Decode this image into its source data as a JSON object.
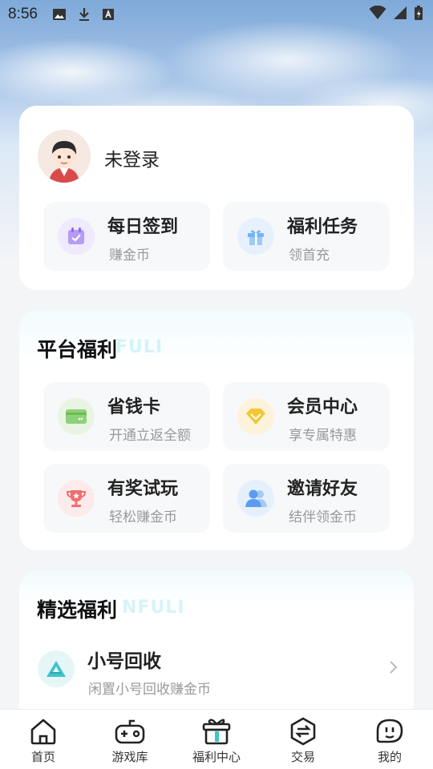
{
  "status_bar": {
    "time": "8:56",
    "left_icons": [
      "image-icon",
      "download-icon",
      "text-a-icon"
    ],
    "right_icons": [
      "wifi-icon",
      "signal-icon",
      "battery-charging-icon"
    ]
  },
  "profile": {
    "username": "未登录",
    "tiles": [
      {
        "title": "每日签到",
        "subtitle": "赚金币",
        "icon": "calendar-check-icon",
        "color": "#a78bfa",
        "bg": "#efeafd"
      },
      {
        "title": "福利任务",
        "subtitle": "领首充",
        "icon": "gift-icon",
        "color": "#60a5fa",
        "bg": "#e6f1fd"
      }
    ]
  },
  "platform": {
    "title": "平台福利",
    "ghost": "FULI",
    "tiles": [
      {
        "title": "省钱卡",
        "subtitle": "开通立返全额",
        "icon": "card-icon",
        "color": "#7cc56a",
        "bg": "#e8f5e4"
      },
      {
        "title": "会员中心",
        "subtitle": "享专属特惠",
        "icon": "diamond-icon",
        "color": "#f4c534",
        "bg": "#fdf3db"
      },
      {
        "title": "有奖试玩",
        "subtitle": "轻松赚金币",
        "icon": "trophy-icon",
        "color": "#f26d6d",
        "bg": "#fdeaea"
      },
      {
        "title": "邀请好友",
        "subtitle": "结伴领金币",
        "icon": "users-icon",
        "color": "#5b9cf2",
        "bg": "#e6f0fd"
      }
    ]
  },
  "selected": {
    "title": "精选福利",
    "ghost": "NFULI",
    "items": [
      {
        "title": "小号回收",
        "subtitle": "闲置小号回收赚金币",
        "icon": "recycle-icon",
        "color": "#3fc4c9"
      }
    ]
  },
  "tabbar": {
    "tabs": [
      {
        "label": "首页",
        "icon": "home-icon"
      },
      {
        "label": "游戏库",
        "icon": "gamepad-icon"
      },
      {
        "label": "福利中心",
        "icon": "gift-box-icon",
        "active": true
      },
      {
        "label": "交易",
        "icon": "exchange-icon"
      },
      {
        "label": "我的",
        "icon": "profile-face-icon"
      }
    ]
  }
}
